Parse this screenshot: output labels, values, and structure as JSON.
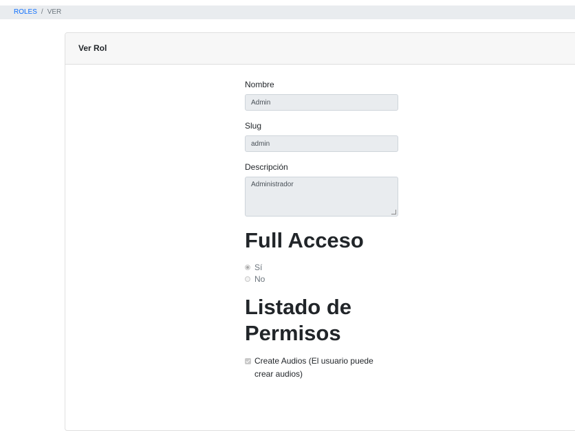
{
  "breadcrumb": {
    "items": [
      "ROLES",
      "VER"
    ],
    "separator": "/"
  },
  "card": {
    "title": "Ver Rol"
  },
  "form": {
    "nombre_label": "Nombre",
    "nombre_value": "Admin",
    "slug_label": "Slug",
    "slug_value": "admin",
    "descripcion_label": "Descripción",
    "descripcion_value": "Administrador"
  },
  "full_acceso": {
    "heading": "Full Acceso",
    "options": [
      {
        "label": "Sí",
        "checked": true
      },
      {
        "label": "No",
        "checked": false
      }
    ]
  },
  "permisos": {
    "heading": "Listado de Permisos",
    "items": [
      {
        "label": "Create Audios (El usuario puede crear audios)",
        "checked": true
      }
    ]
  },
  "colors": {
    "link": "#0d6efd",
    "breadcrumb_bg": "#e9ecef",
    "card_header_bg": "#f7f7f7",
    "input_disabled_bg": "#e9ecef"
  }
}
